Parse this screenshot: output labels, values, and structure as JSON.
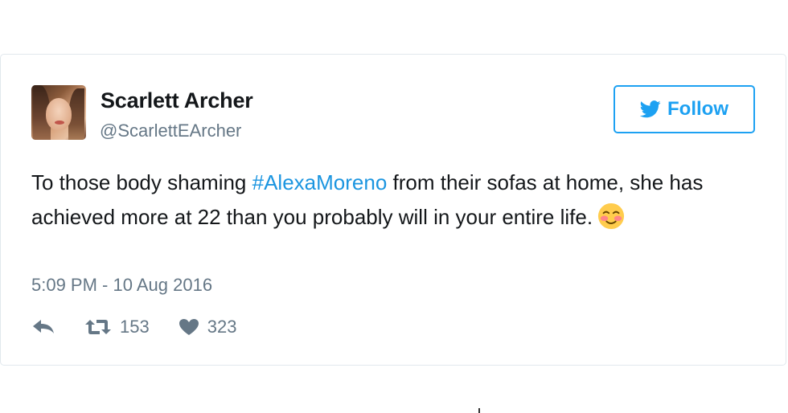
{
  "tweet": {
    "author": {
      "display_name": "Scarlett Archer",
      "handle": "@ScarlettEArcher",
      "avatar_icon": "profile-photo"
    },
    "follow_button": {
      "label": "Follow",
      "icon": "twitter-bird-icon",
      "accent_color": "#1da1f2"
    },
    "text": {
      "part1": "To those body shaming ",
      "hashtag": "#AlexaMoreno",
      "part2": " from their sofas at home, she has achieved more at 22 than you probably will in your entire life.",
      "emoji": "smiling-blushing-face-emoji"
    },
    "timestamp": "5:09 PM - 10 Aug 2016",
    "actions": {
      "reply_icon": "reply-icon",
      "retweet_icon": "retweet-icon",
      "retweet_count": "153",
      "like_icon": "heart-icon",
      "like_count": "323"
    }
  },
  "colors": {
    "text": "#14171a",
    "secondary_text": "#657786",
    "link": "#1b95e0",
    "border": "#e1e8ed"
  }
}
